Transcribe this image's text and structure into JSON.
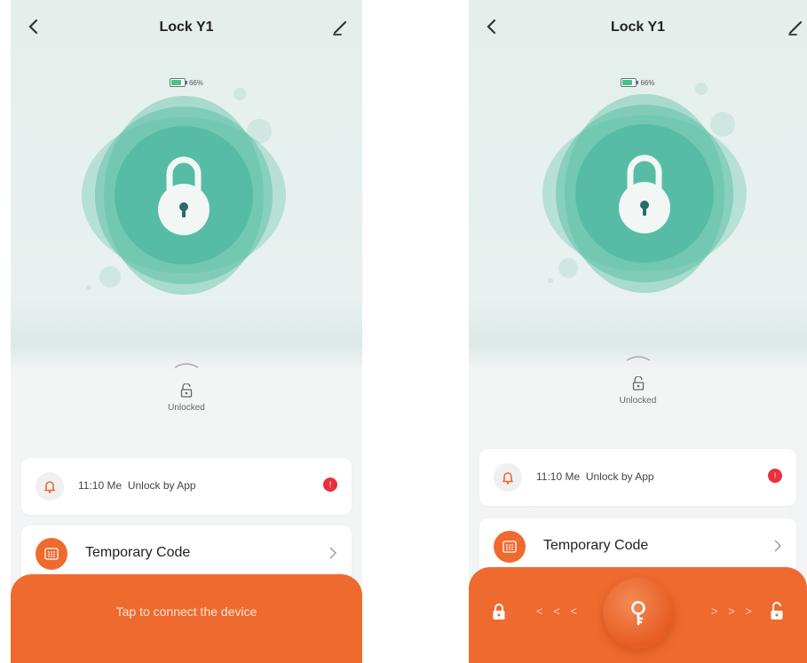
{
  "screens": [
    {
      "title": "Lock Y1",
      "battery_percent": "66%",
      "lock_state": "Unlocked",
      "log": {
        "time": "11:10 Me",
        "text": "Unlock by App",
        "badge": "!"
      },
      "temp_code_label": "Temporary Code",
      "bottom_text": "Tap to connect the device"
    },
    {
      "title": "Lock Y1",
      "battery_percent": "66%",
      "lock_state": "Unlocked",
      "log": {
        "time": "11:10 Me",
        "text": "Unlock by App",
        "badge": "!"
      },
      "temp_code_label": "Temporary Code",
      "arrows_left": "< < <",
      "arrows_right": "> > >"
    }
  ],
  "colors": {
    "accent": "#ee6a2e",
    "teal": "#3fb8a0",
    "badge_red": "#e8313d"
  },
  "icons": [
    "back-arrow-icon",
    "edit-pencil-icon",
    "battery-icon",
    "padlock-icon",
    "unlocked-padlock-icon",
    "bell-icon",
    "keypad-icon",
    "chevron-right-icon",
    "key-icon"
  ]
}
